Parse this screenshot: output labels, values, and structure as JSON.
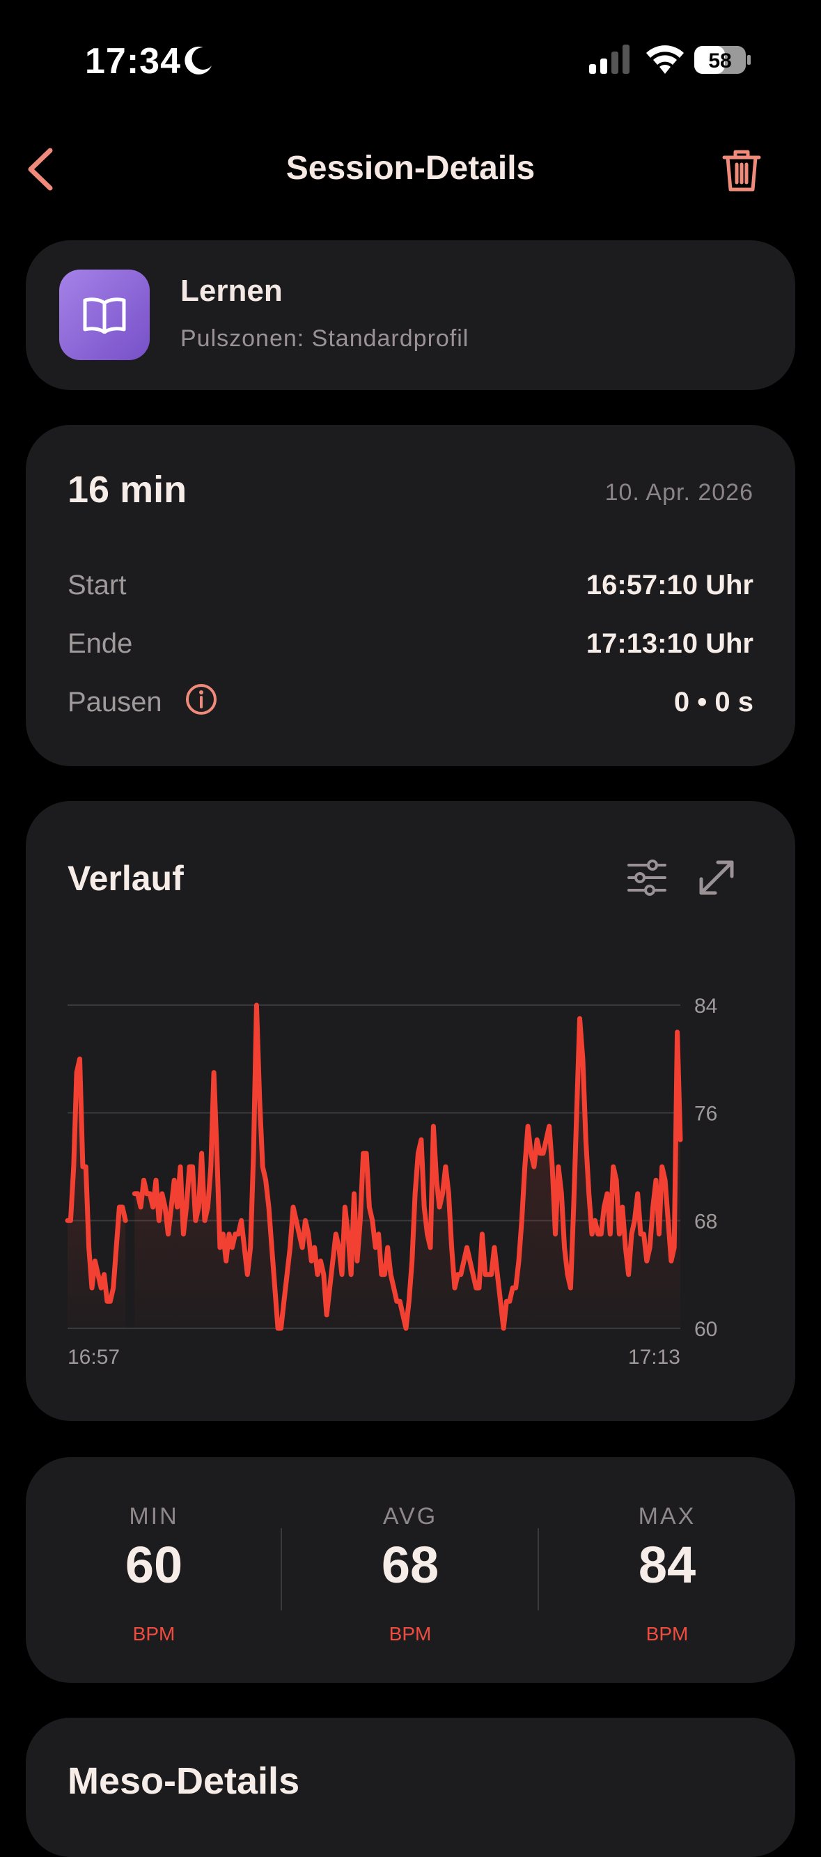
{
  "status_bar": {
    "time": "17:34",
    "battery": "58"
  },
  "header": {
    "title": "Session-Details"
  },
  "activity": {
    "name": "Lernen",
    "subtitle": "Pulszonen: Standardprofil",
    "icon": "book-icon"
  },
  "summary": {
    "duration": "16 min",
    "date": "10. Apr. 2026",
    "rows": [
      {
        "label": "Start",
        "value": "16:57:10 Uhr"
      },
      {
        "label": "Ende",
        "value": "17:13:10 Uhr"
      },
      {
        "label": "Pausen",
        "value": "0 • 0 s"
      }
    ]
  },
  "history": {
    "title": "Verlauf"
  },
  "chart_data": {
    "type": "line",
    "x_start": "16:57",
    "x_end": "17:13",
    "y_ticks": [
      "84",
      "76",
      "68",
      "60"
    ],
    "ylim": [
      60,
      84
    ],
    "grid": true,
    "color": "#f24133",
    "values": [
      68,
      68,
      72,
      79,
      80,
      72,
      72,
      66,
      63,
      65,
      64,
      63,
      64,
      62,
      62,
      63,
      66,
      69,
      69,
      68,
      null,
      null,
      70,
      70,
      69,
      71,
      70,
      70,
      69,
      71,
      68,
      70,
      69,
      67,
      69,
      71,
      69,
      72,
      67,
      69,
      72,
      72,
      68,
      69,
      73,
      68,
      69,
      72,
      79,
      73,
      66,
      67,
      65,
      67,
      66,
      67,
      67,
      68,
      66,
      64,
      66,
      73,
      84,
      77,
      72,
      71,
      69,
      66,
      63,
      60,
      60,
      62,
      64,
      66,
      69,
      68,
      67,
      66,
      68,
      67,
      65,
      66,
      64,
      65,
      64,
      61,
      63,
      65,
      67,
      66,
      64,
      69,
      67,
      64,
      70,
      65,
      68,
      73,
      73,
      69,
      68,
      66,
      67,
      64,
      64,
      66,
      64,
      63,
      62,
      62,
      61,
      60,
      62,
      65,
      70,
      73,
      74,
      69,
      67,
      66,
      75,
      71,
      69,
      70,
      72,
      70,
      66,
      63,
      64,
      64,
      65,
      66,
      65,
      64,
      63,
      63,
      67,
      64,
      64,
      64,
      66,
      64,
      62,
      60,
      62,
      62,
      63,
      63,
      65,
      68,
      72,
      75,
      73,
      72,
      74,
      73,
      73,
      74,
      75,
      72,
      67,
      72,
      70,
      66,
      64,
      63,
      69,
      76,
      83,
      80,
      74,
      70,
      67,
      68,
      67,
      67,
      69,
      70,
      67,
      72,
      71,
      67,
      69,
      66,
      64,
      67,
      68,
      70,
      67,
      67,
      65,
      66,
      69,
      71,
      67,
      72,
      71,
      68,
      65,
      66,
      82,
      74
    ]
  },
  "stats": [
    {
      "label": "MIN",
      "value": "60",
      "unit": "BPM"
    },
    {
      "label": "AVG",
      "value": "68",
      "unit": "BPM"
    },
    {
      "label": "MAX",
      "value": "84",
      "unit": "BPM"
    }
  ],
  "meso": {
    "title": "Meso-Details"
  }
}
